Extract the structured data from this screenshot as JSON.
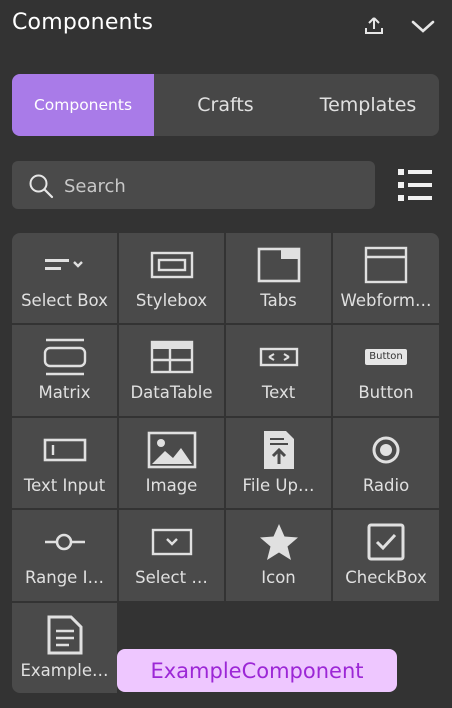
{
  "panel": {
    "title": "Components"
  },
  "tabs": [
    {
      "label": "Components",
      "active": true
    },
    {
      "label": "Crafts",
      "active": false
    },
    {
      "label": "Templates",
      "active": false
    }
  ],
  "search": {
    "placeholder": "Search",
    "value": ""
  },
  "components": [
    {
      "label": "Select Box",
      "icon": "select-box-icon"
    },
    {
      "label": "Stylebox",
      "icon": "stylebox-icon"
    },
    {
      "label": "Tabs",
      "icon": "tabs-icon"
    },
    {
      "label": "Webform…",
      "icon": "webform-icon"
    },
    {
      "label": "Matrix",
      "icon": "matrix-icon"
    },
    {
      "label": "DataTable",
      "icon": "datatable-icon"
    },
    {
      "label": "Text",
      "icon": "text-icon"
    },
    {
      "label": "Button",
      "icon": "button-icon",
      "icon_text": "Button"
    },
    {
      "label": "Text Input",
      "icon": "text-input-icon"
    },
    {
      "label": "Image",
      "icon": "image-icon"
    },
    {
      "label": "File Up…",
      "icon": "file-upload-icon"
    },
    {
      "label": "Radio",
      "icon": "radio-icon"
    },
    {
      "label": "Range I…",
      "icon": "range-input-icon"
    },
    {
      "label": "Select …",
      "icon": "select-icon"
    },
    {
      "label": "Icon",
      "icon": "star-icon"
    },
    {
      "label": "CheckBox",
      "icon": "checkbox-icon"
    },
    {
      "label": "Example…",
      "icon": "document-icon"
    }
  ],
  "tooltip": {
    "text": "ExampleComponent"
  },
  "colors": {
    "accent": "#a97be8",
    "background": "#333333",
    "tile": "#4a4a4a",
    "tooltip_bg": "#eec7ff",
    "tooltip_text": "#9c27d6"
  }
}
